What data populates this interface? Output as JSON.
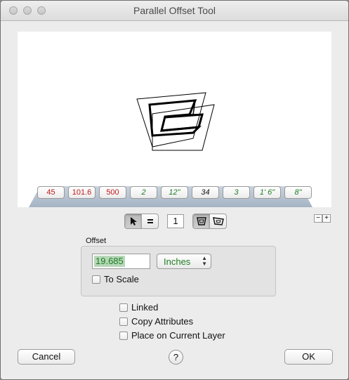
{
  "window": {
    "title": "Parallel Offset Tool"
  },
  "preset_chips": [
    {
      "label": "45",
      "color": "red"
    },
    {
      "label": "101.6",
      "color": "red"
    },
    {
      "label": "500",
      "color": "red"
    },
    {
      "label": "2",
      "color": "green"
    },
    {
      "label": "12\"",
      "color": "green"
    },
    {
      "label": "34",
      "color": "black"
    },
    {
      "label": "3",
      "color": "green"
    },
    {
      "label": "1' 6\"",
      "color": "green"
    },
    {
      "label": "8\"",
      "color": "green"
    }
  ],
  "toolbar": {
    "mode_buttons": [
      {
        "icon": "arrow-pointer-icon",
        "selected": true
      },
      {
        "icon": "equals-icon",
        "selected": false
      }
    ],
    "count_value": "1",
    "shape_buttons": [
      {
        "icon": "offset-shape-inward-icon",
        "selected": true
      },
      {
        "icon": "offset-shape-outward-icon",
        "selected": false
      }
    ],
    "zoom_out_label": "−",
    "zoom_in_label": "+"
  },
  "offset": {
    "group_label": "Offset",
    "value": "19.685",
    "unit": "Inches",
    "to_scale_label": "To Scale",
    "to_scale_checked": false
  },
  "options": [
    {
      "label": "Linked",
      "checked": false
    },
    {
      "label": "Copy Attributes",
      "checked": false
    },
    {
      "label": "Place on Current Layer",
      "checked": false
    }
  ],
  "footer": {
    "cancel_label": "Cancel",
    "help_label": "?",
    "ok_label": "OK"
  },
  "colors": {
    "red_text": "#c01818",
    "green_text": "#1d7d22",
    "selection": "#b7d7b9"
  }
}
